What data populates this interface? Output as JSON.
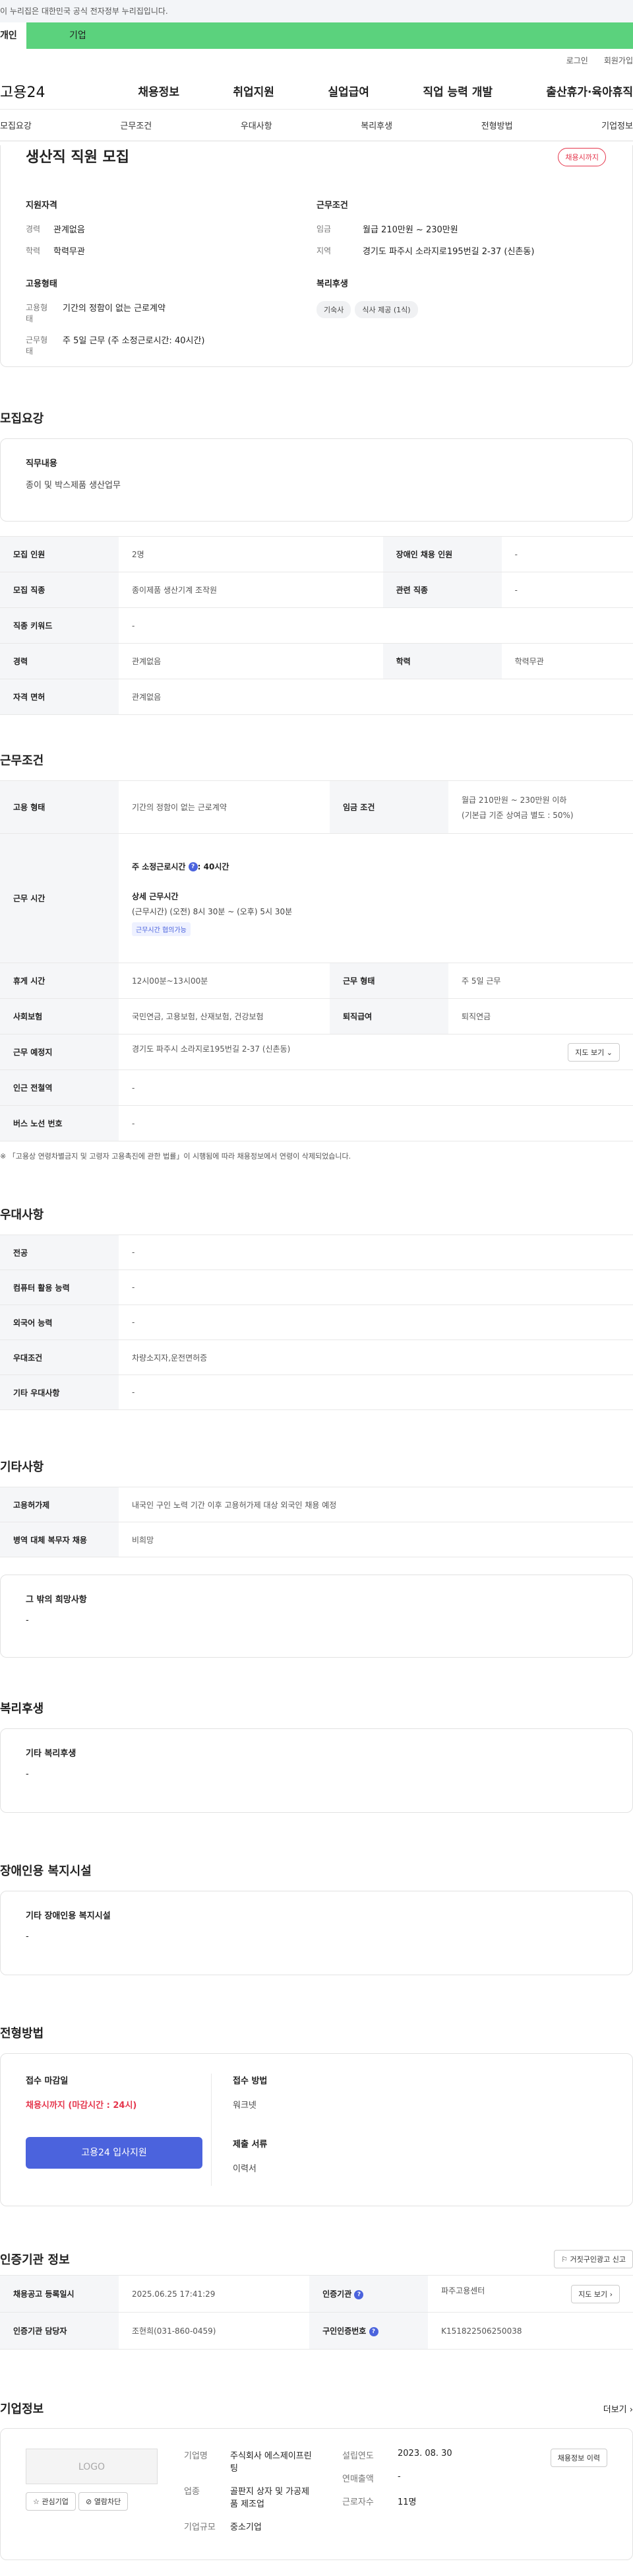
{
  "gov_banner": "이 누리집은 대한민국 공식 전자정부 누리집입니다.",
  "user_tabs": {
    "personal": "개인",
    "company": "기업"
  },
  "utils": [
    "로그인",
    "회원가입"
  ],
  "gnb": {
    "logo": "고용24",
    "menus": [
      "채용정보",
      "취업지원",
      "실업급여",
      "직업 능력 개발",
      "출산휴가·육아휴직"
    ]
  },
  "anchors": [
    "모집요강",
    "근무조건",
    "우대사항",
    "복리후생",
    "전형방법",
    "기업정보"
  ],
  "summary": {
    "title": "생산직 직원 모집",
    "deadline_badge": "채용시까지",
    "qual_title": "지원자격",
    "career_k": "경력",
    "career_v": "관계없음",
    "edu_k": "학력",
    "edu_v": "학력무관",
    "emp_title": "고용형태",
    "emp_k1": "고용형태",
    "emp_v1": "기간의 정함이 없는 근로계약",
    "emp_k2": "근무형태",
    "emp_v2": "주 5일 근무 (주 소정근로시간: 40시간)",
    "cond_title": "근무조건",
    "wage_k": "임금",
    "wage_v": "월급 210만원 ~ 230만원",
    "loc_k": "지역",
    "loc_v": "경기도 파주시 소라지로195번길 2-37 (신촌동)",
    "welfare_title": "복리후생",
    "chips": [
      "기숙사",
      "식사 제공 (1식)"
    ]
  },
  "recruit": {
    "title": "모집요강",
    "duty_label": "직무내용",
    "duty_value": "종이 및 박스제품 생산업무",
    "rows": [
      {
        "k1": "모집 인원",
        "v1": "2명",
        "k2": "장애인 채용 인원",
        "v2": "-"
      },
      {
        "k1": "모집 직종",
        "v1": "종이제품 생산기계 조작원",
        "k2": "관련 직종",
        "v2": "-"
      },
      {
        "k1": "직종 키워드",
        "v1": "-"
      },
      {
        "k1": "경력",
        "v1": "관계없음",
        "k2": "학력",
        "v2": "학력무관"
      },
      {
        "k1": "자격 면허",
        "v1": "관계없음"
      }
    ]
  },
  "conditions": {
    "title": "근무조건",
    "emp_type_k": "고용 형태",
    "emp_type_v": "기간의 정함이 없는 근로계약",
    "wage_k": "임금 조건",
    "wage_v1": "월급 210만원 ~ 230만원 이하",
    "wage_v2": "(기본급 기준 상여금 별도 : 50%)",
    "hours_k": "근무 시간",
    "weekly_label": "주 소정근로시간",
    "weekly_value": ": 40시간",
    "detail_label": "상세 근무시간",
    "detail_value": "(근무시간) (오전) 8시 30분 ~ (오후) 5시 30분",
    "consult_tag": "근무시간 협의가능",
    "rest_k": "휴게 시간",
    "rest_v": "12시00분~13시00분",
    "form_k": "근무 형태",
    "form_v": "주 5일 근무",
    "ins_k": "사회보험",
    "ins_v": "국민연금, 고용보험, 산재보험, 건강보험",
    "ret_k": "퇴직급여",
    "ret_v": "퇴직연금",
    "place_k": "근무 예정지",
    "place_v": "경기도 파주시 소라지로195번길 2-37 (신촌동)",
    "map_btn": "지도 보기",
    "subway_k": "인근 전철역",
    "subway_v": "-",
    "bus_k": "버스 노선 번호",
    "bus_v": "-",
    "notice": "※ 「고용상 연령차별금지 및 고령자 고용촉진에 관한 법률」이 시행됨에 따라 채용정보에서 연령이 삭제되었습니다."
  },
  "preference": {
    "title": "우대사항",
    "rows": [
      {
        "k": "전공",
        "v": "-"
      },
      {
        "k": "컴퓨터 활용 능력",
        "v": "-"
      },
      {
        "k": "외국어 능력",
        "v": "-"
      },
      {
        "k": "우대조건",
        "v": "차량소지자,운전면허증"
      },
      {
        "k": "기타 우대사항",
        "v": "-"
      }
    ]
  },
  "etc": {
    "title": "기타사항",
    "rows": [
      {
        "k": "고용허가제",
        "v": "내국인 구인 노력 기간 이후 고용허가제 대상 외국인 채용 예정"
      },
      {
        "k": "병역 대체 복무자 채용",
        "v": "비희망"
      }
    ],
    "other_label": "그 밖의 희망사항",
    "other_value": "-"
  },
  "welfare": {
    "title": "복리후생",
    "label": "기타 복리후생",
    "value": "-"
  },
  "disabled": {
    "title": "장애인용 복지시설",
    "label": "기타 장애인용 복지시설",
    "value": "-"
  },
  "process": {
    "title": "전형방법",
    "deadline_label": "접수 마감일",
    "deadline_value": "채용시까지 (마감시간 : 24시)",
    "apply_btn": "고용24 입사지원",
    "method_label": "접수 방법",
    "method_value": "워크넷",
    "docs_label": "제출 서류",
    "docs_value": "이력서"
  },
  "cert": {
    "title": "인증기관 정보",
    "report_btn": "거짓구인광고 신고",
    "reg_k": "채용공고 등록일시",
    "reg_v": "2025.06.25 17:41:29",
    "org_k": "인증기관",
    "org_v": "파주고용센터",
    "map_btn": "지도 보기",
    "mgr_k": "인증기관 담당자",
    "mgr_v": "조현희(031-860-0459)",
    "no_k": "구인인증번호",
    "no_v": "K151822506250038"
  },
  "company": {
    "title": "기업정보",
    "more": "더보기",
    "logo": "LOGO",
    "fav_btn": "관심기업",
    "block_btn": "열람차단",
    "name_k": "기업명",
    "name_v": "주식회사 에스제이프린팅",
    "biz_k": "업종",
    "biz_v": "골판지 상자 및 가공제품 제조업",
    "size_k": "기업규모",
    "size_v": "중소기업",
    "est_k": "설립연도",
    "est_v": "2023. 08. 30",
    "sales_k": "연매출액",
    "sales_v": "-",
    "emp_k": "근로자수",
    "emp_v": "11명",
    "jobs_btn": "채용정보 이력"
  }
}
